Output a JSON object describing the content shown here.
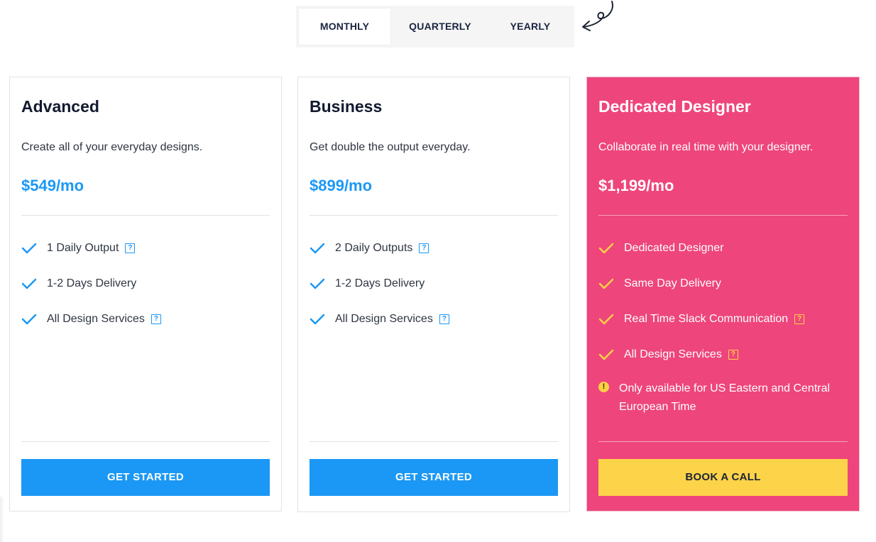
{
  "billing_toggle": {
    "tabs": [
      {
        "label": "MONTHLY",
        "active": true
      },
      {
        "label": "QUARTERLY",
        "active": false
      },
      {
        "label": "YEARLY",
        "active": false
      }
    ]
  },
  "colors": {
    "accent_blue": "#1b98f5",
    "featured_pink": "#ee457c",
    "accent_yellow": "#fdd349",
    "text_dark": "#111a30"
  },
  "plans": [
    {
      "title": "Advanced",
      "description": "Create all of your everyday designs.",
      "price": "$549/mo",
      "features": [
        {
          "label": "1 Daily Output",
          "help": true
        },
        {
          "label": "1-2 Days Delivery",
          "help": false
        },
        {
          "label": "All Design Services",
          "help": true
        }
      ],
      "cta": "GET STARTED"
    },
    {
      "title": "Business",
      "description": "Get double the output everyday.",
      "price": "$899/mo",
      "features": [
        {
          "label": "2 Daily Outputs",
          "help": true
        },
        {
          "label": "1-2 Days Delivery",
          "help": false
        },
        {
          "label": "All Design Services",
          "help": true
        }
      ],
      "cta": "GET STARTED"
    },
    {
      "title": "Dedicated Designer",
      "description": "Collaborate in real time with your designer.",
      "price": "$1,199/mo",
      "features": [
        {
          "label": "Dedicated Designer",
          "help": false
        },
        {
          "label": "Same Day Delivery",
          "help": false
        },
        {
          "label": "Real Time Slack Communication",
          "help": true
        },
        {
          "label": "All Design Services",
          "help": true
        }
      ],
      "note": "Only available for US Eastern and Central European Time",
      "cta": "BOOK A CALL"
    }
  ],
  "icons": {
    "check": "checkmark-icon",
    "help": "?",
    "warning": "!",
    "arrow": "curly-arrow-icon"
  }
}
